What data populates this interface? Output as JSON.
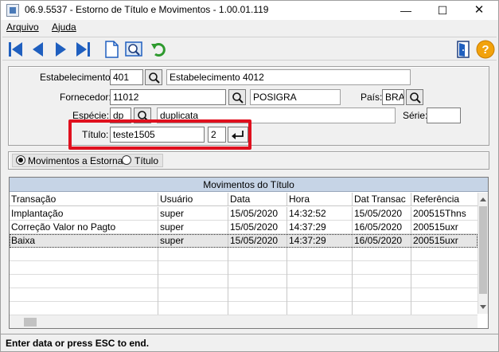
{
  "window": {
    "title": "06.9.5537 - Estorno de Título e Movimentos - 1.00.01.119",
    "minimize": "—",
    "maximize": "☐",
    "close": "✕"
  },
  "menu": {
    "items": [
      "Arquivo",
      "Ajuda"
    ]
  },
  "toolbar": {
    "buttons": [
      "first-icon",
      "previous-icon",
      "next-icon",
      "last-icon",
      "document-icon",
      "search-zoom-icon",
      "refresh-icon",
      "exit-door-icon",
      "help-icon"
    ],
    "accent": "#1f5fbf"
  },
  "form": {
    "estabelecimento": {
      "label": "Estabelecimento:",
      "code": "401",
      "desc": "Estabelecimento 4012"
    },
    "fornecedor": {
      "label": "Fornecedor:",
      "code": "11012",
      "desc": "POSIGRA"
    },
    "pais": {
      "label": "País:",
      "value": "BRA"
    },
    "especie": {
      "label": "Espécie:",
      "code": "dp",
      "desc": "duplicata"
    },
    "serie": {
      "label": "Série:",
      "value": ""
    },
    "titulo": {
      "label": "Título:",
      "value": "teste1505",
      "parcela": "2"
    },
    "highlight_color": "#e0101e"
  },
  "options": {
    "radio1": "Movimentos a Estornar",
    "radio2": "Título",
    "selected": "Movimentos a Estornar"
  },
  "grid": {
    "title": "Movimentos do Título",
    "columns": [
      "Transação",
      "Usuário",
      "Data",
      "Hora",
      "Dat Transac",
      "Referência"
    ],
    "rows": [
      [
        "Implantação",
        "super",
        "15/05/2020",
        "14:32:52",
        "15/05/2020",
        "200515Thns"
      ],
      [
        "Correção Valor no Pagto",
        "super",
        "15/05/2020",
        "14:37:29",
        "16/05/2020",
        "200515uxr"
      ],
      [
        "Baixa",
        "super",
        "15/05/2020",
        "14:37:29",
        "16/05/2020",
        "200515uxr"
      ]
    ],
    "selected_row": 2
  },
  "status": {
    "text": "Enter data or press ESC to end."
  }
}
